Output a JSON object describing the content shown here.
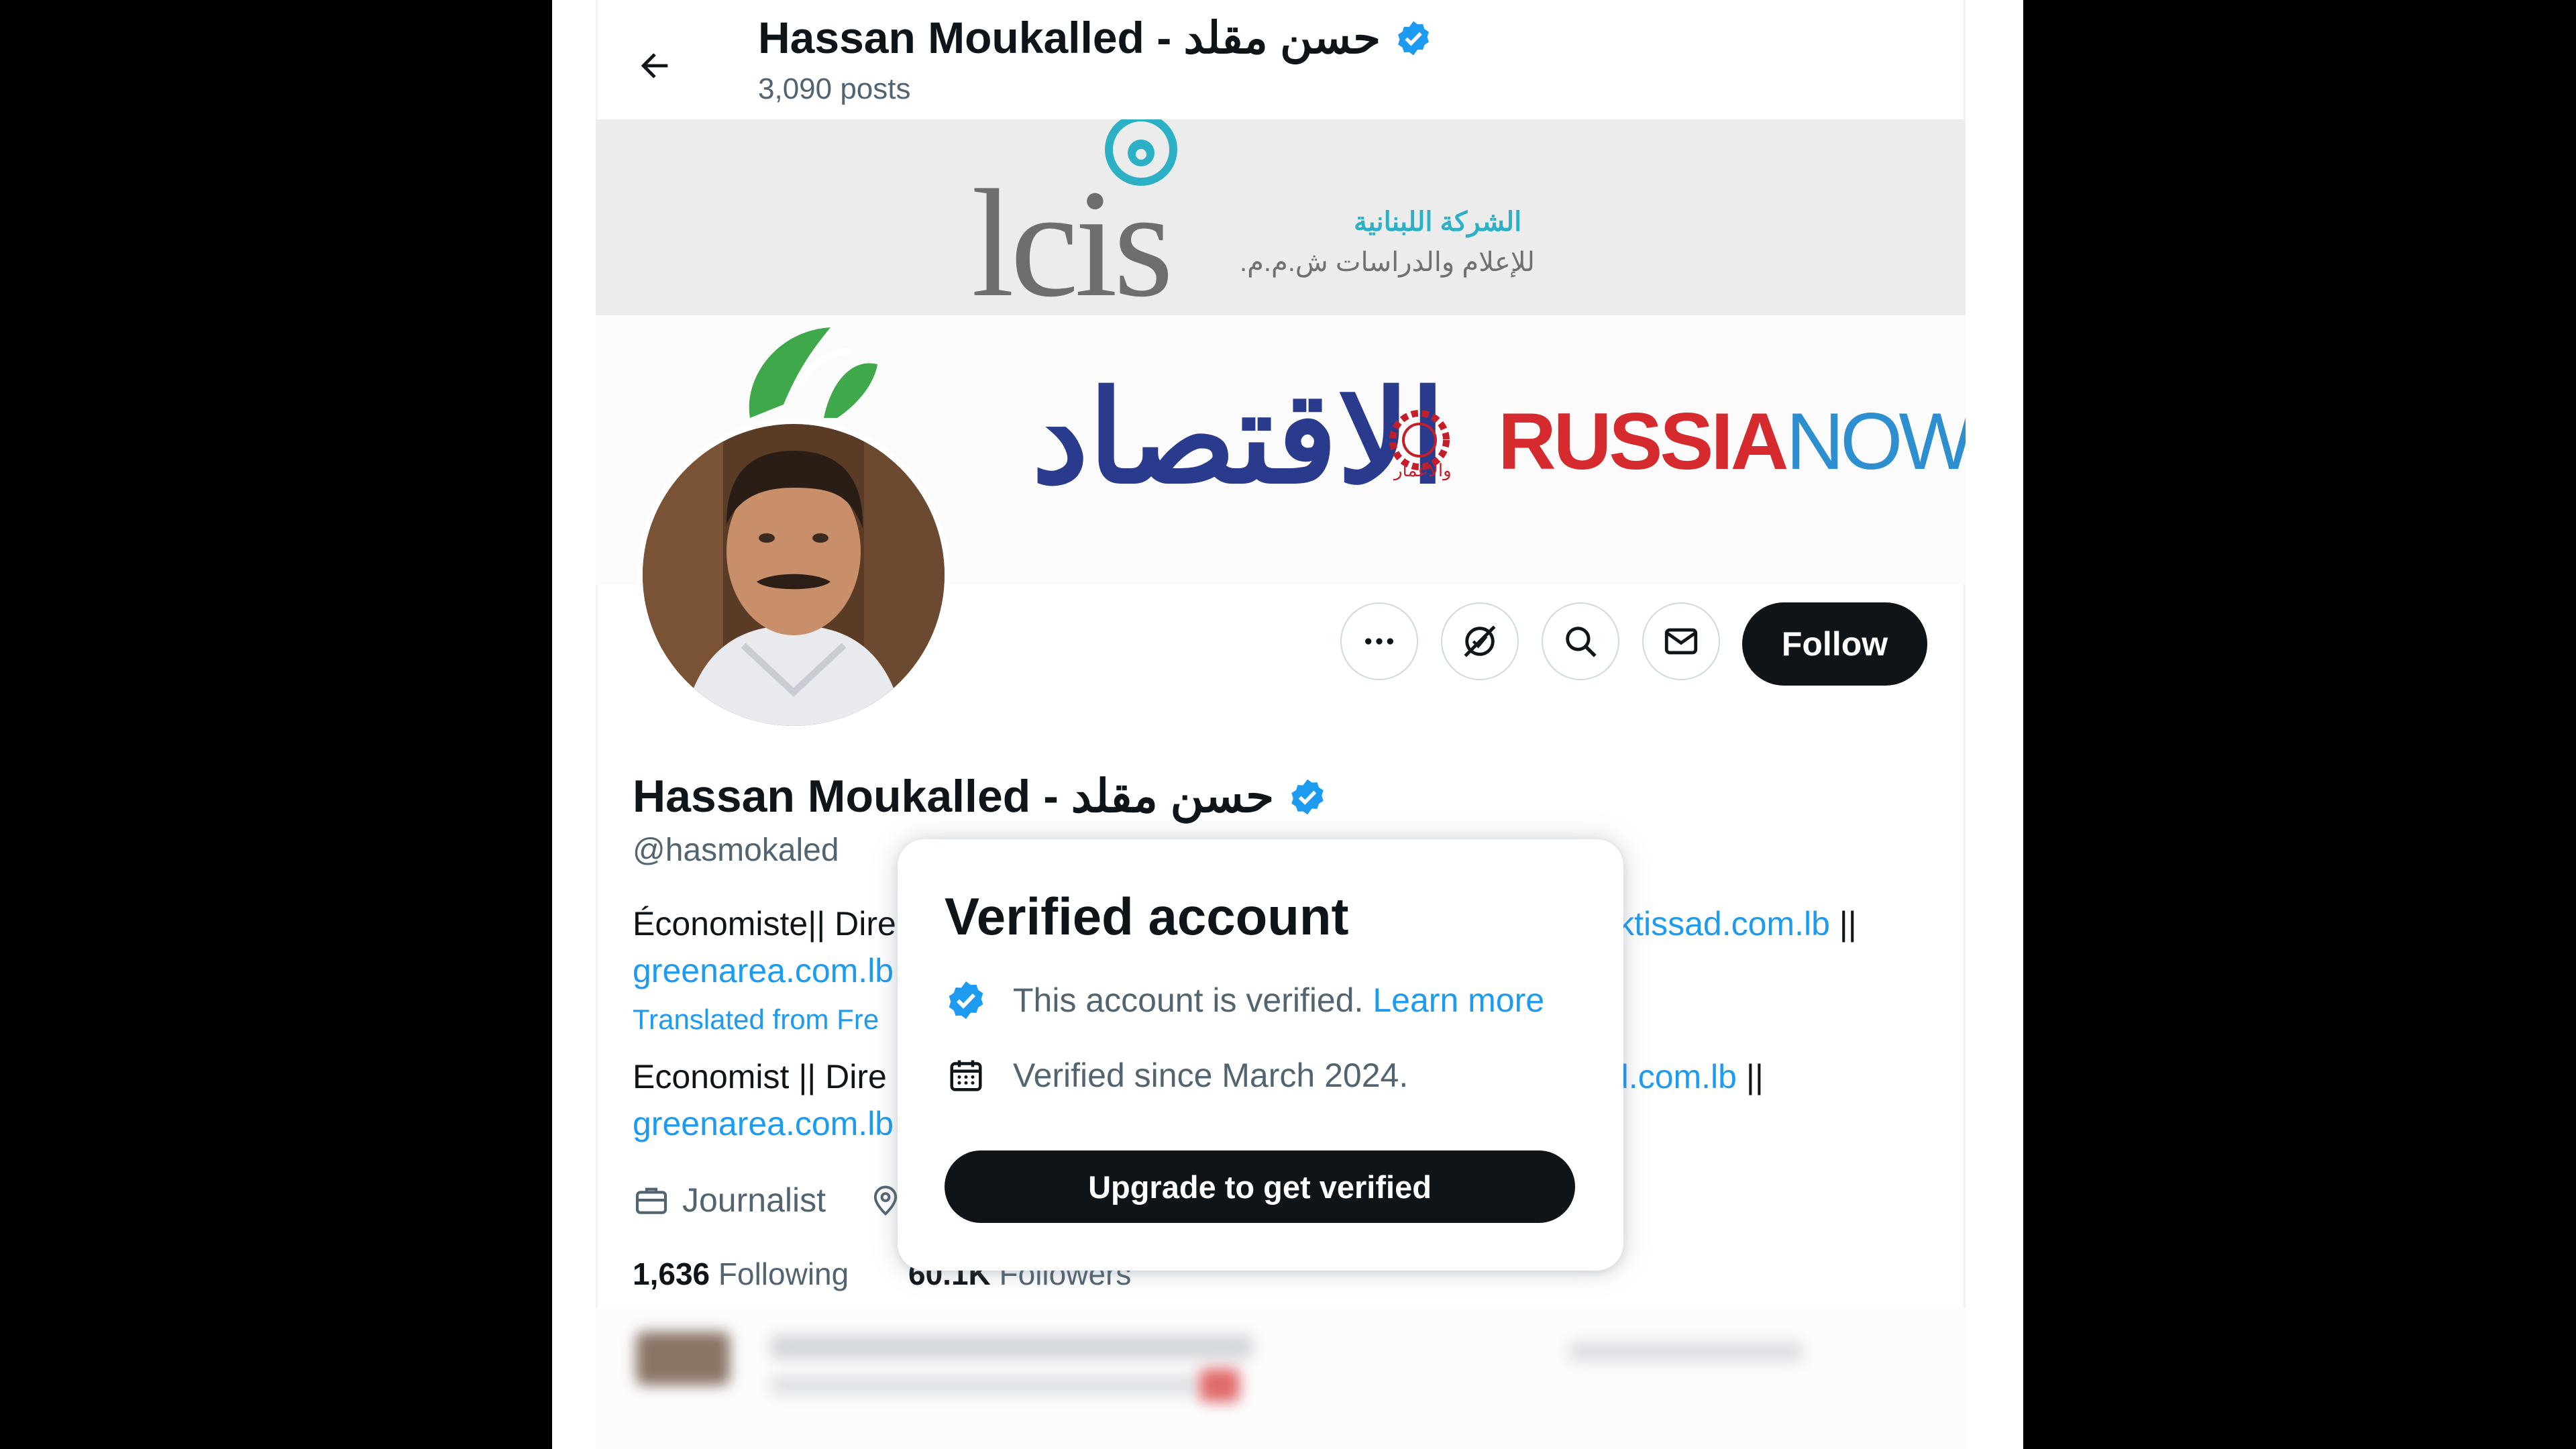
{
  "header": {
    "title": "Hassan Moukalled - حسن مقلد",
    "posts_count": "3,090 posts"
  },
  "banner": {
    "lcis_logo_text": "lcis",
    "lcis_arabic_line1": "الشركة اللبنانية",
    "lcis_arabic_line2": "للإعلام والدراسات ش.م.م.",
    "iqtissad_logo_text": "الاقتصاد",
    "iqtissad_sub_text": "والاعمار",
    "russia_logo_part1": "RUSSIA",
    "russia_logo_part2": "NOW"
  },
  "actions": {
    "follow_label": "Follow"
  },
  "profile": {
    "name": "Hassan Moukalled - حسن مقلد",
    "handle": "@hasmokaled",
    "bio_original_start": "Économiste|| Dire",
    "bio_original_end": "iktissad.com.lb",
    "bio_separator": "||",
    "bio_original_link2": "greenarea.com.lb",
    "translated_label": "Translated from Fre",
    "bio_translated_start": "Economist || Dire",
    "bio_translated_end": "d.com.lb",
    "bio_translated_link2": "greenarea.com.lb",
    "job": "Journalist",
    "following_count": "1,636",
    "following_label": "Following",
    "followers_count": "60.1K",
    "followers_label": "Followers"
  },
  "hovercard": {
    "title": "Verified account",
    "verified_text": "This account is verified.",
    "learn_more": "Learn more",
    "since_text": "Verified since March 2024.",
    "upgrade_label": "Upgrade to get verified"
  },
  "colors": {
    "accent_blue": "#1d9bf0",
    "text_primary": "#0f1419",
    "text_secondary": "#536471",
    "button_dark": "#0f1419"
  },
  "icons": [
    "back-arrow-icon",
    "verified-badge-icon",
    "more-icon",
    "subscribe-icon",
    "search-icon",
    "mail-icon",
    "briefcase-icon",
    "location-pin-icon",
    "calendar-icon"
  ]
}
